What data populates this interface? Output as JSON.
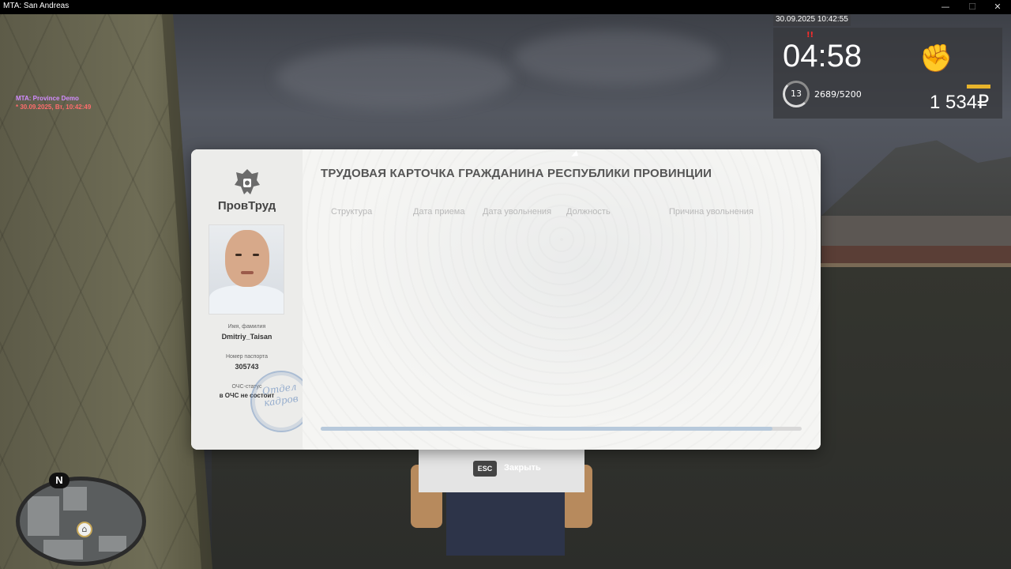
{
  "window": {
    "title": "MTA: San Andreas"
  },
  "debug": {
    "server": "MTA: Province Demo",
    "datetime": "* 30.09.2025, Вт, 10:42:49"
  },
  "hud": {
    "datetime": "30.09.2025 10:42:55",
    "time": "04:58",
    "wanted_marker": "!!",
    "level": "13",
    "experience": "2689/5200",
    "money": "1 534₽",
    "hunger_level": 1.0
  },
  "minimap": {
    "north_label": "N"
  },
  "card": {
    "title": "ТРУДОВАЯ КАРТОЧКА ГРАЖДАНИНА РЕСПУБЛИКИ ПРОВИНЦИИ",
    "org_name": "ПровТруд",
    "name_label": "Имя, фамилия",
    "name_value": "Dmitriy_Taisan",
    "passport_label": "Номер паспорта",
    "passport_value": "305743",
    "status_label": "ОЧС-статус",
    "status_value": "в ОЧС не состоит",
    "stamp_text": "Отдел кадров",
    "columns": [
      "Структура",
      "Дата приема",
      "Дата увольнения",
      "Должность",
      "Причина увольнения"
    ],
    "rows": [],
    "scroll_position": 0.94
  },
  "close_hint": {
    "key": "ESC",
    "label": "Закрыть"
  }
}
